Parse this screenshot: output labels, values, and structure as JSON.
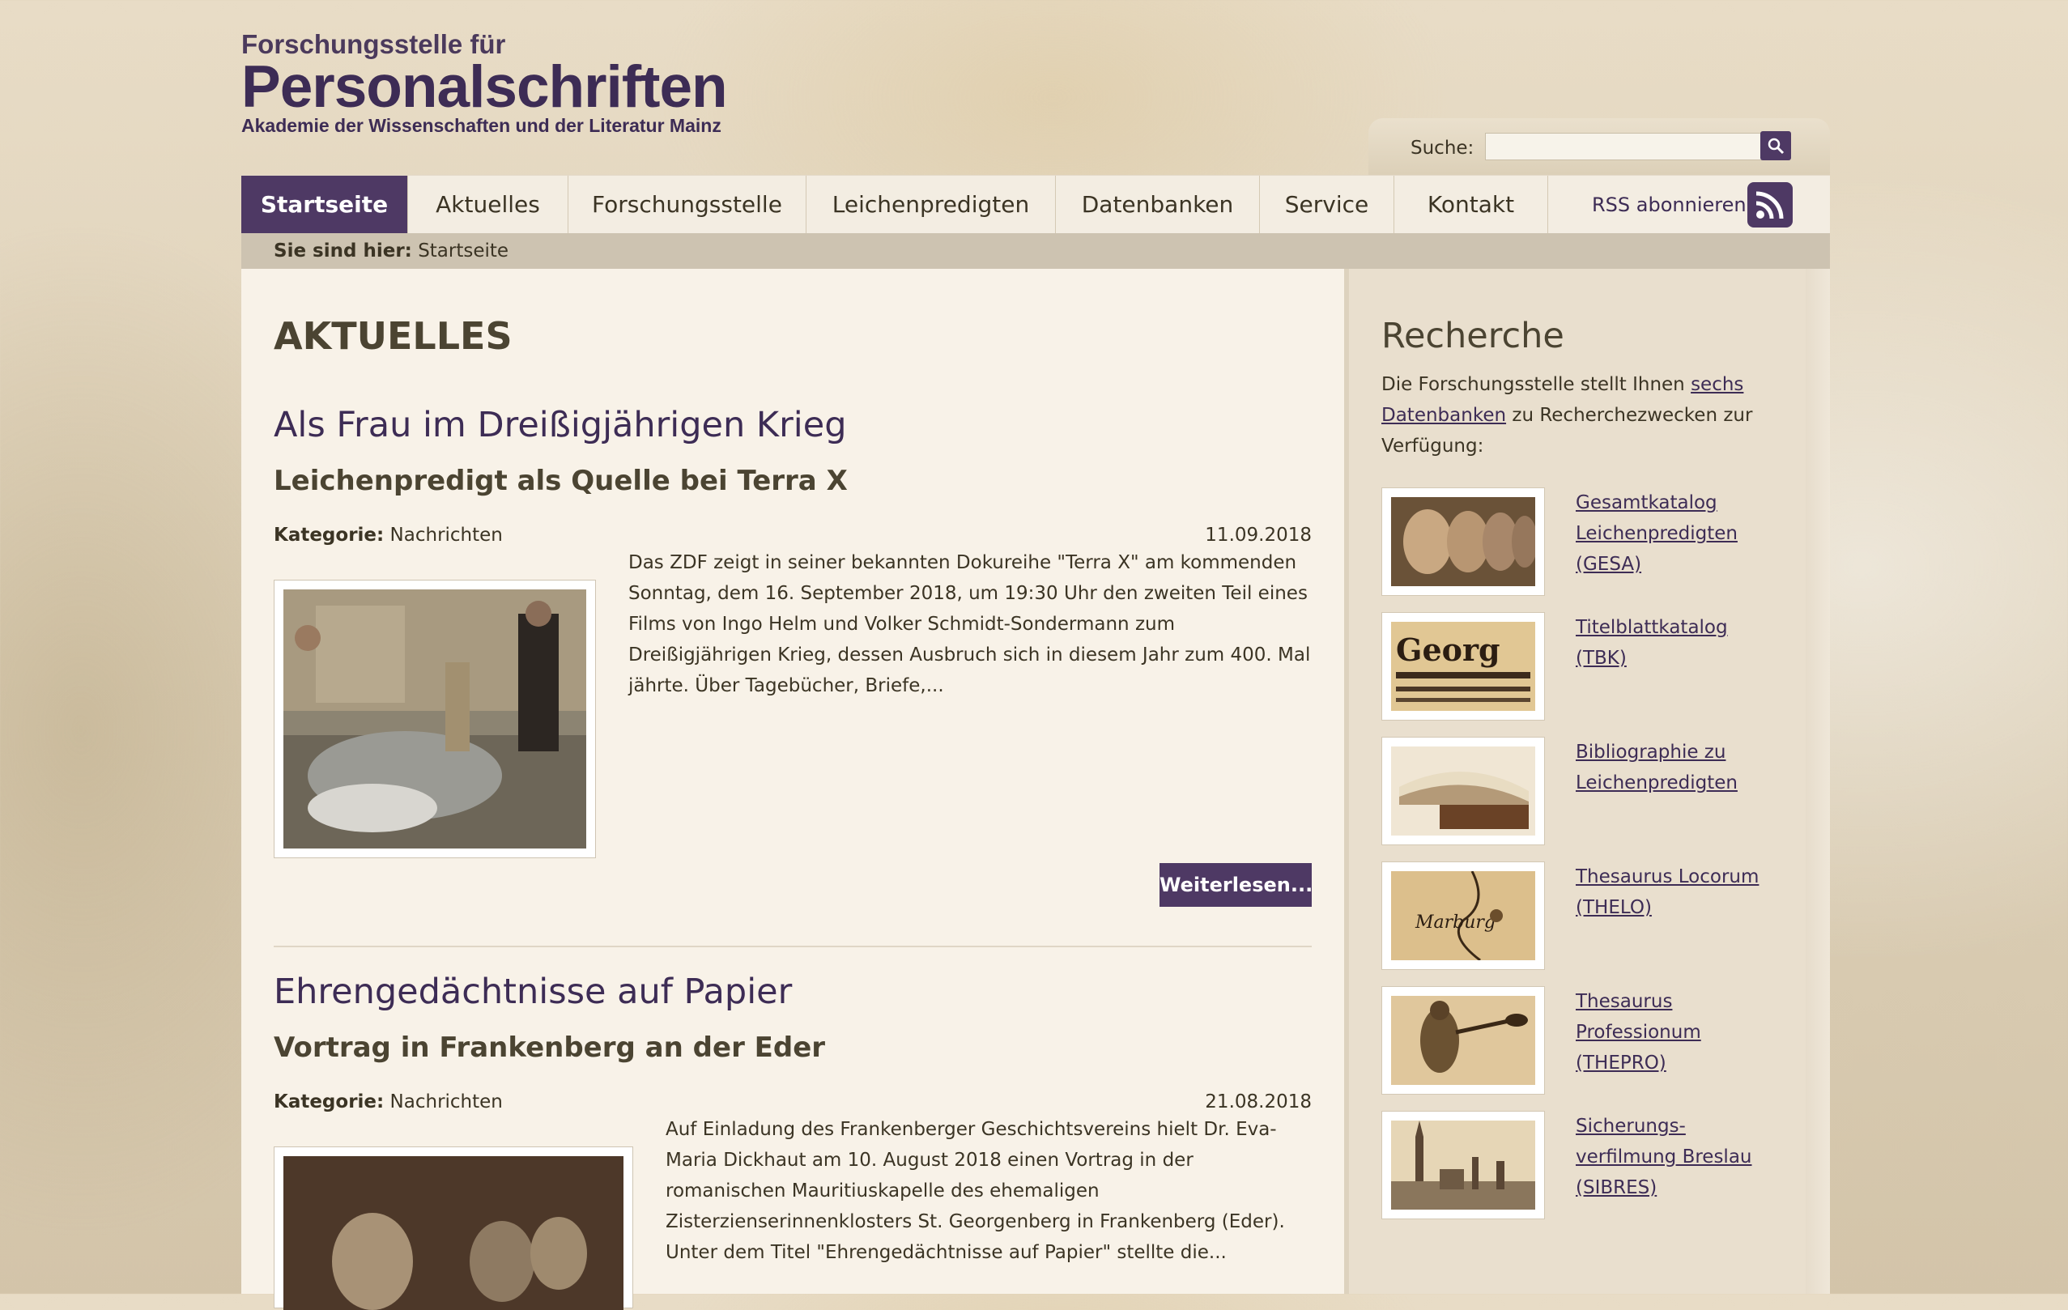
{
  "logo": {
    "line1": "Forschungsstelle für",
    "line2": "Personalschriften",
    "line3": "Akademie der Wissenschaften und der Literatur Mainz"
  },
  "search": {
    "label": "Suche:",
    "value": ""
  },
  "nav": {
    "items": [
      "Startseite",
      "Aktuelles",
      "Forschungsstelle",
      "Leichenpredigten",
      "Datenbanken",
      "Service",
      "Kontakt"
    ],
    "rss_label": "RSS abonnieren"
  },
  "breadcrumb": {
    "prefix": "Sie sind hier:",
    "current": "Startseite"
  },
  "main": {
    "heading": "AKTUELLES",
    "articles": [
      {
        "title": "Als Frau im Dreißigjährigen Krieg",
        "subtitle": "Leichenpredigt als Quelle bei Terra X",
        "category_label": "Kategorie:",
        "category": "Nachrichten",
        "date": "11.09.2018",
        "text": "Das ZDF zeigt in seiner bekannten Dokureihe \"Terra X\" am kommenden Sonntag, dem 16. September 2018, um 19:30 Uhr den zweiten Teil eines Films von Ingo Helm und Volker Schmidt-Sondermann zum Dreißigjährigen Krieg, dessen Ausbruch sich in diesem Jahr zum 400. Mal jährte. Über Tagebücher, Briefe,...",
        "more": "Weiterlesen..."
      },
      {
        "title": "Ehrengedächtnisse auf Papier",
        "subtitle": "Vortrag in Frankenberg an der Eder",
        "category_label": "Kategorie:",
        "category": "Nachrichten",
        "date": "21.08.2018",
        "text": "Auf Einladung des Frankenberger Geschichtsvereins hielt Dr. Eva-Maria Dickhaut am 10. August 2018 einen Vortrag in der romanischen Mauritiuskapelle des ehemaligen Zisterzienserinnenklosters St. Georgenberg in Frankenberg (Eder). Unter dem Titel \"Ehrengedächtnisse auf Papier\" stellte die..."
      }
    ]
  },
  "sidebar": {
    "title": "Recherche",
    "intro_before": "Die Forschungsstelle stellt Ihnen",
    "intro_link": "sechs Datenbanken",
    "intro_after": "zu Recherchezwecken zur Verfügung:",
    "databases": [
      "Gesamtkatalog Leichenpredigten (GESA)",
      "Titelblattkatalog (TBK)",
      "Bibliographie zu Leichenpredigten",
      "Thesaurus Locorum (THELO)",
      "Thesaurus Professionum (THEPRO)",
      "Sicherungs-verfilmung Breslau (SIBRES)"
    ]
  },
  "colors": {
    "accent": "#4e3964",
    "link": "#3d2c55",
    "background": "#e3d6bf"
  }
}
